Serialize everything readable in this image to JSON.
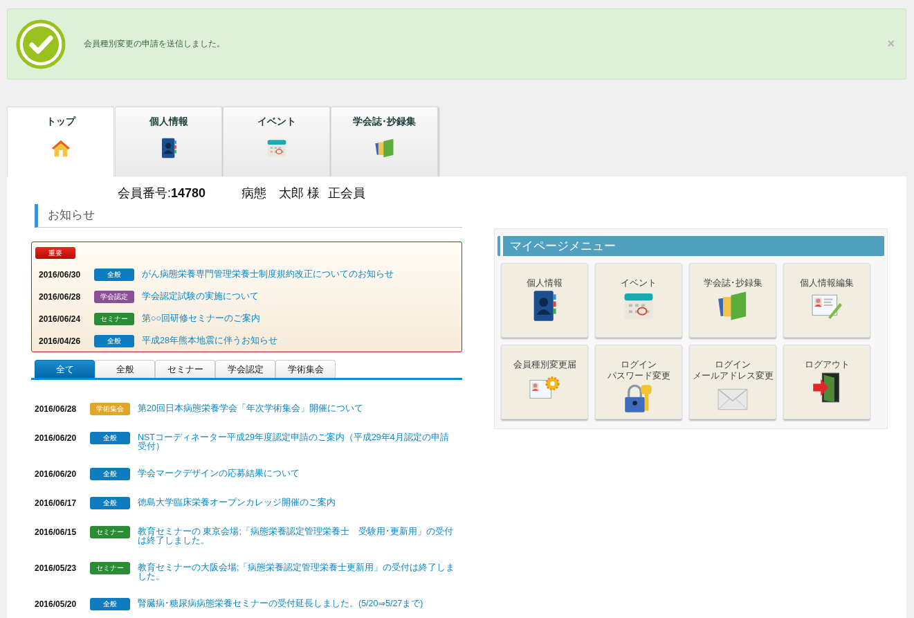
{
  "alert": {
    "message": "会員種別変更の申請を送信しました。",
    "close": "×"
  },
  "tabs": [
    {
      "label": "トップ",
      "kind": "home",
      "selected": true
    },
    {
      "label": "個人情報",
      "kind": "address-book",
      "selected": false
    },
    {
      "label": "イベント",
      "kind": "calendar",
      "selected": false
    },
    {
      "label": "学会誌･抄録集",
      "kind": "journal",
      "selected": false
    }
  ],
  "member": {
    "number_label": "会員番号:",
    "number": "14780",
    "name": "病態　太郎 様",
    "grade": "正会員"
  },
  "notices": {
    "title": "お知らせ",
    "important": {
      "badge": "重要",
      "items": [
        {
          "date": "2016/06/30",
          "category": "全般",
          "color": "#0e7cbf",
          "title": "がん病態栄養専門管理栄養士制度規約改正についてのお知らせ"
        },
        {
          "date": "2016/06/28",
          "category": "学会認定",
          "color": "#8a4f96",
          "title": "学会認定試験の実施について"
        },
        {
          "date": "2016/06/24",
          "category": "セミナー",
          "color": "#2a8c34",
          "title": "第○○回研修セミナーのご案内"
        },
        {
          "date": "2016/04/26",
          "category": "全般",
          "color": "#0e7cbf",
          "title": "平成28年熊本地震に伴うお知らせ"
        }
      ]
    },
    "filters": [
      {
        "label": "全て",
        "selected": true
      },
      {
        "label": "全般",
        "selected": false
      },
      {
        "label": "セミナー",
        "selected": false
      },
      {
        "label": "学会認定",
        "selected": false
      },
      {
        "label": "学術集会",
        "selected": false
      }
    ],
    "items": [
      {
        "date": "2016/06/28",
        "category": "学術集会",
        "color": "#e0a628",
        "title": "第20回日本病態栄養学会「年次学術集会」開催について"
      },
      {
        "date": "2016/06/20",
        "category": "全般",
        "color": "#0e7cbf",
        "title": "NSTコーディネーター平成29年度認定申請のご案内（平成29年4月認定の申請受付）"
      },
      {
        "date": "2016/06/20",
        "category": "全般",
        "color": "#0e7cbf",
        "title": "学会マークデザインの応募結果について"
      },
      {
        "date": "2016/06/17",
        "category": "全般",
        "color": "#0e7cbf",
        "title": "徳島大学臨床栄養オープンカレッジ開催のご案内"
      },
      {
        "date": "2016/06/15",
        "category": "セミナー",
        "color": "#2a8c34",
        "title": "教育セミナーの 東京会場;「病態栄養認定管理栄養士　受験用･更新用」の受付は終了しました。"
      },
      {
        "date": "2016/05/23",
        "category": "セミナー",
        "color": "#2a8c34",
        "title": "教育セミナーの大阪会場;「病態栄養認定管理栄養士更新用」の受付は終了しました。"
      },
      {
        "date": "2016/05/20",
        "category": "全般",
        "color": "#0e7cbf",
        "title": "腎臓病･糖尿病病態栄養セミナーの受付延長しました。(5/20⇒5/27まで)"
      }
    ]
  },
  "menu": {
    "title": "マイページメニュー",
    "items": [
      {
        "lines": [
          "個人情報"
        ],
        "kind": "address-book"
      },
      {
        "lines": [
          "イベント"
        ],
        "kind": "calendar"
      },
      {
        "lines": [
          "学会誌･抄録集"
        ],
        "kind": "journal"
      },
      {
        "lines": [
          "個人情報編集"
        ],
        "kind": "id-edit"
      },
      {
        "lines": [
          "会員種別変更届"
        ],
        "kind": "id-gear"
      },
      {
        "lines": [
          "ログイン",
          "パスワード変更"
        ],
        "kind": "lock-key"
      },
      {
        "lines": [
          "ログイン",
          "メールアドレス変更"
        ],
        "kind": "envelope"
      },
      {
        "lines": [
          "ログアウト"
        ],
        "kind": "exit-door"
      }
    ]
  }
}
